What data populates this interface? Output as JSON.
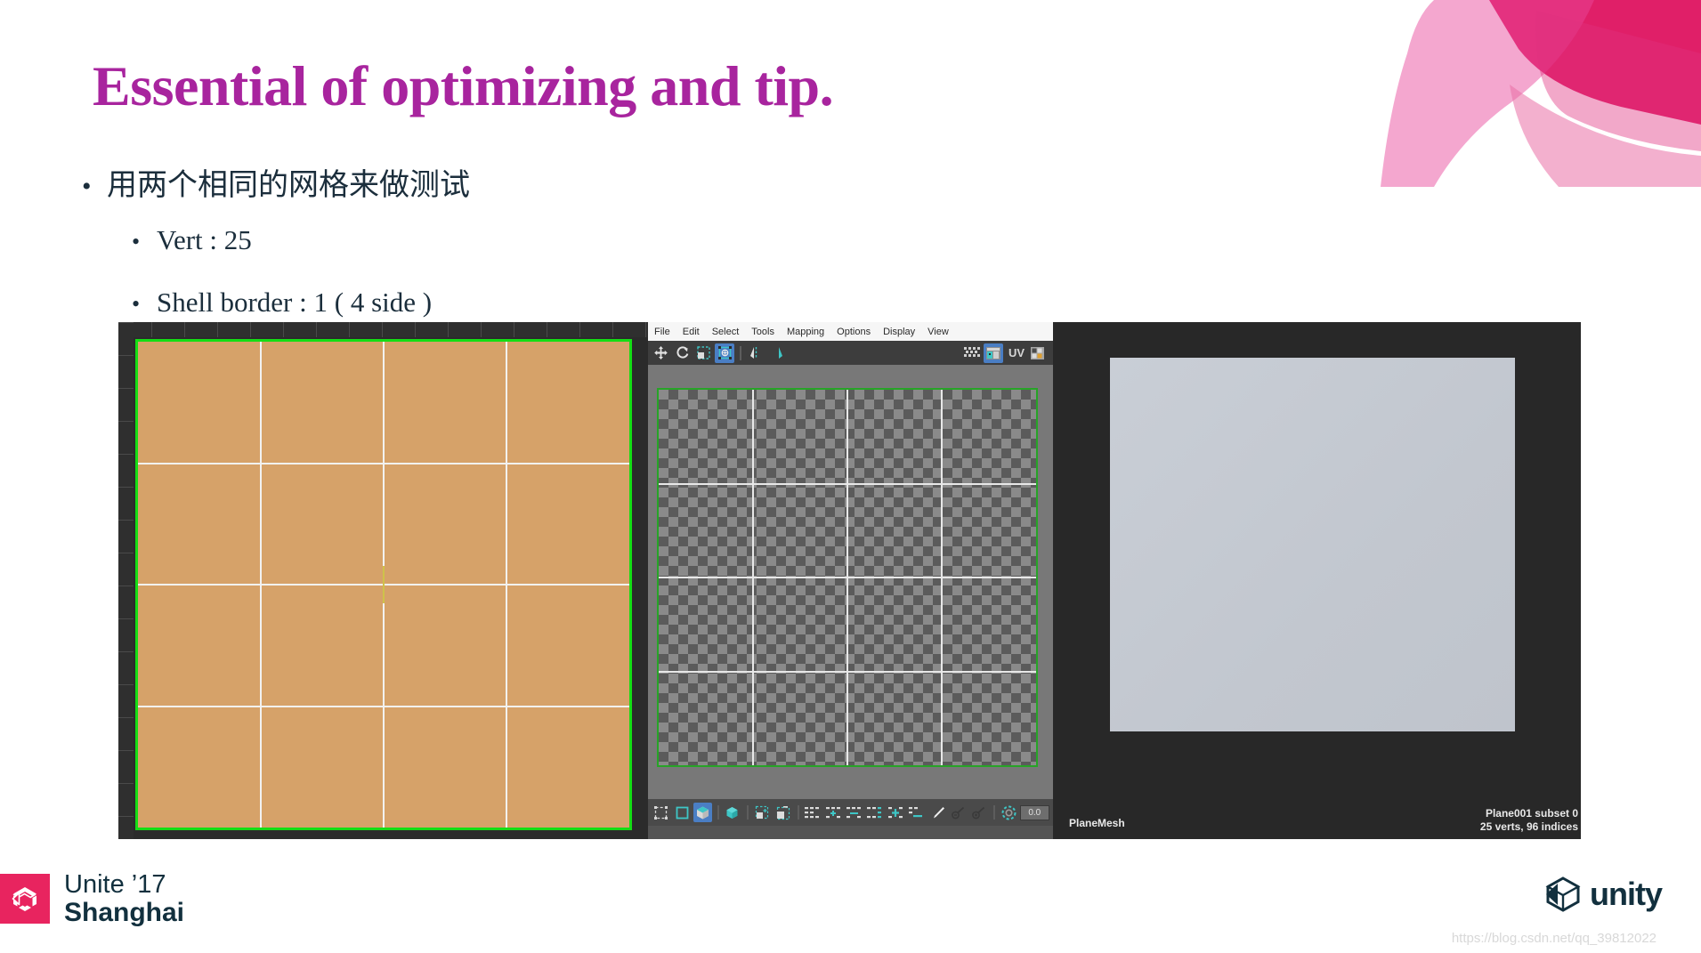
{
  "slide": {
    "title": "Essential of optimizing and tip.",
    "title_color": "#a8249e",
    "bullets": [
      {
        "marker": "•",
        "text": "用两个相同的网格来做测试",
        "level": 1
      },
      {
        "marker": "•",
        "text": "Vert : 25",
        "level": 2
      },
      {
        "marker": "•",
        "text": "Shell border : 1 ( 4 side )",
        "level": 2
      }
    ]
  },
  "uv_editor": {
    "menu": [
      "File",
      "Edit",
      "Select",
      "Tools",
      "Mapping",
      "Options",
      "Display",
      "View"
    ],
    "toolbar_icons": [
      "move-icon",
      "rotate-icon",
      "scale-icon",
      "transform-box-icon",
      "mirror-horizontal-icon",
      "mirror-vertical-icon"
    ],
    "right_toolbar": {
      "icons": [
        "checker-grid-icon",
        "uv-texture-icon",
        "uv-snapshot-icon"
      ],
      "label": "UV"
    },
    "bottom_toolbar": {
      "icons": [
        "uv-shell-select-icon",
        "face-select-icon",
        "element-select-icon",
        "object-select-icon",
        "soft-select-icon",
        "hard-select-icon",
        "align-left-icon",
        "align-center-h-icon",
        "align-right-icon",
        "align-top-icon",
        "align-center-v-icon",
        "align-bottom-icon",
        "brush-icon",
        "relax-icon",
        "unfold-icon",
        "pivot-snap-icon"
      ],
      "numeric_value": "0.0"
    },
    "grid": {
      "rows": 4,
      "cols": 4,
      "border_color": "#27a427"
    }
  },
  "viewport_left": {
    "mesh_color": "#d6a269",
    "selection_border_color": "#14dd14",
    "grid": {
      "rows": 4,
      "cols": 4
    }
  },
  "viewport_right": {
    "object_label": "PlaneMesh",
    "stats_line1": "Plane001 subset 0",
    "stats_line2": "25 verts, 96 indices",
    "plane_color": "#c4c9d1",
    "background_color": "#282828"
  },
  "footer": {
    "event_year": "Unite ’17",
    "event_city": "Shanghai",
    "brand": "unity",
    "brand_color": "#12303e",
    "accent_color": "#e8245f",
    "watermark": "https://blog.csdn.net/qq_39812022"
  }
}
